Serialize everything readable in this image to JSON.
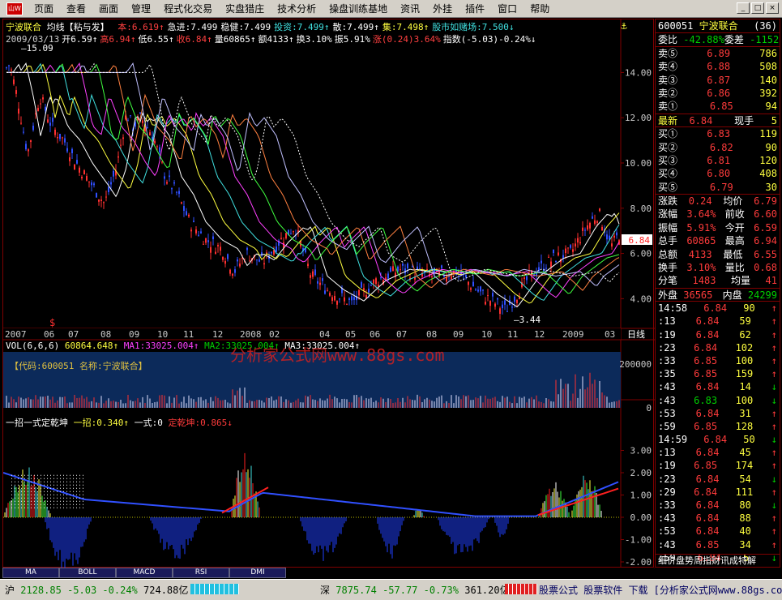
{
  "menu": [
    "页面",
    "查看",
    "画面",
    "管理",
    "程式化交易",
    "实盘猎庄",
    "技术分析",
    "操盘训练基地",
    "资讯",
    "外挂",
    "插件",
    "窗口",
    "帮助"
  ],
  "win_buttons": [
    "_",
    "□",
    "×"
  ],
  "header": {
    "name": "宁波联合",
    "period": "均线【粘与发】",
    "items": [
      "本:6.619↑",
      "急进:7.499",
      "稳健:7.499",
      "投资:7.499↑",
      "散:7.499↑",
      "集:7.498↑",
      "股市如赌场:7.500↓"
    ],
    "line2": [
      "2009/03/13",
      "开6.59↑",
      "高6.94↑",
      "低6.55↑",
      "收6.84↑",
      "量60865↑",
      "额4133↑",
      "换3.10%",
      "振5.91%",
      "涨(0.24)3.64%",
      "指数(-5.03)-0.24%↓"
    ],
    "anchor": "⚓"
  },
  "chart_data": [
    {
      "type": "line",
      "title": "宁波联合 均线【粘与发】",
      "ylim": [
        3.44,
        15.09
      ],
      "yticks": [
        "14.00",
        "12.00",
        "10.00",
        "8.00",
        "6.00",
        "4.00"
      ],
      "annotations": [
        "15.09",
        "3.44"
      ],
      "price_tag": "6.84",
      "x_labels": [
        "2007",
        "06",
        "07",
        "08",
        "09",
        "10",
        "11",
        "12",
        "2008",
        "02",
        "04",
        "05",
        "06",
        "07",
        "08",
        "09",
        "10",
        "11",
        "12",
        "2009",
        "03"
      ],
      "period_label": "日线",
      "price_marker": "$"
    },
    {
      "type": "bar",
      "title": "VOL(6,6,6)",
      "series": [
        {
          "name": "VOL",
          "value": 60864.648
        },
        {
          "name": "MA1",
          "value": 33025.004
        },
        {
          "name": "MA2",
          "value": 33025.004
        },
        {
          "name": "MA3",
          "value": 33025.004
        }
      ],
      "yticks": [
        "200000",
        "0"
      ],
      "info": "【代码:600051  名称:宁波联合】"
    },
    {
      "type": "bar",
      "title": "一招一式定乾坤",
      "series": [
        {
          "name": "一招",
          "value": 0.34
        },
        {
          "name": "一式",
          "value": 0
        },
        {
          "name": "定乾坤",
          "value": 0.865
        }
      ],
      "yticks": [
        "3.00",
        "2.00",
        "1.00",
        "0.00",
        "-1.00",
        "-2.00"
      ]
    }
  ],
  "vol_labels": {
    "vol": "VOL(6,6,6)",
    "v": "60864.648↑",
    "ma1": "MA1:33025.004↑",
    "ma2": "MA2:33025.004↑",
    "ma3": "MA3:33025.004↑"
  },
  "ind_labels": {
    "title": "一招一式定乾坤",
    "a": "一招:0.340↑",
    "b": "一式:0",
    "c": "定乾坤:0.865↓"
  },
  "watermark": "分析家公式网www.88gs.com",
  "tabs": [
    "MA",
    "BOLL",
    "MACD",
    "RSI",
    "DMI"
  ],
  "sidebar": {
    "code": "600051",
    "name": "宁波联合",
    "count": "(36)",
    "wb": {
      "l1": "委比",
      "v1": "-42.88%",
      "l2": "委差",
      "v2": "-1152"
    },
    "asks": [
      {
        "l": "卖⑤",
        "p": "6.89",
        "v": "786"
      },
      {
        "l": "卖④",
        "p": "6.88",
        "v": "508"
      },
      {
        "l": "卖③",
        "p": "6.87",
        "v": "140"
      },
      {
        "l": "卖②",
        "p": "6.86",
        "v": "392"
      },
      {
        "l": "卖①",
        "p": "6.85",
        "v": "94"
      }
    ],
    "last": {
      "l": "最新",
      "p": "6.84",
      "l2": "现手",
      "v": "5"
    },
    "bids": [
      {
        "l": "买①",
        "p": "6.83",
        "v": "119"
      },
      {
        "l": "买②",
        "p": "6.82",
        "v": "90"
      },
      {
        "l": "买③",
        "p": "6.81",
        "v": "120"
      },
      {
        "l": "买④",
        "p": "6.80",
        "v": "408"
      },
      {
        "l": "买⑤",
        "p": "6.79",
        "v": "30"
      }
    ],
    "stats": [
      [
        "涨跌",
        "0.24",
        "均价",
        "6.79"
      ],
      [
        "涨幅",
        "3.64%",
        "前收",
        "6.60"
      ],
      [
        "振幅",
        "5.91%",
        "今开",
        "6.59"
      ],
      [
        "总手",
        "60865",
        "最高",
        "6.94"
      ],
      [
        "总额",
        "4133",
        "最低",
        "6.55"
      ],
      [
        "换手",
        "3.10%",
        "量比",
        "0.68"
      ],
      [
        "分笔",
        "1483",
        "均量",
        "41"
      ]
    ],
    "outer": {
      "l1": "外盘",
      "v1": "36565",
      "l2": "内盘",
      "v2": "24299"
    },
    "ticks": [
      [
        "14:58",
        "6.84",
        "90",
        "↑"
      ],
      [
        ":13",
        "6.84",
        "59",
        "↑"
      ],
      [
        ":19",
        "6.84",
        "62",
        "↑"
      ],
      [
        ":23",
        "6.84",
        "102",
        "↑"
      ],
      [
        ":33",
        "6.85",
        "100",
        "↑"
      ],
      [
        ":35",
        "6.85",
        "159",
        "↑"
      ],
      [
        ":43",
        "6.84",
        "14",
        "↓"
      ],
      [
        ":43",
        "6.83",
        "100",
        "↓"
      ],
      [
        ":53",
        "6.84",
        "31",
        "↑"
      ],
      [
        ":59",
        "6.85",
        "128",
        "↑"
      ],
      [
        "14:59",
        "6.84",
        "50",
        "↓"
      ],
      [
        ":13",
        "6.84",
        "45",
        "↑"
      ],
      [
        ":19",
        "6.85",
        "174",
        "↑"
      ],
      [
        ":23",
        "6.84",
        "54",
        "↓"
      ],
      [
        ":29",
        "6.84",
        "111",
        "↑"
      ],
      [
        ":33",
        "6.84",
        "80",
        "↓"
      ],
      [
        ":43",
        "6.84",
        "88",
        "↑"
      ],
      [
        ":53",
        "6.84",
        "40",
        "↑"
      ],
      [
        ":43",
        "6.85",
        "34",
        "↑"
      ],
      [
        ":59",
        "6.84",
        "5",
        "↓"
      ]
    ],
    "footer": "细价盘势周指财讯成特解"
  },
  "status": {
    "sh": "沪",
    "sh_v": "2128.85",
    "sh_c": "-5.03",
    "sh_p": "-0.24%",
    "sh_a": "724.88亿",
    "sz": "深",
    "sz_v": "7875.74",
    "sz_c": "-57.77",
    "sz_p": "-0.73%",
    "sz_a": "361.20亿",
    "ad": "股票公式 股票软件 下载 [分析家公式网www.88gs.com]"
  }
}
